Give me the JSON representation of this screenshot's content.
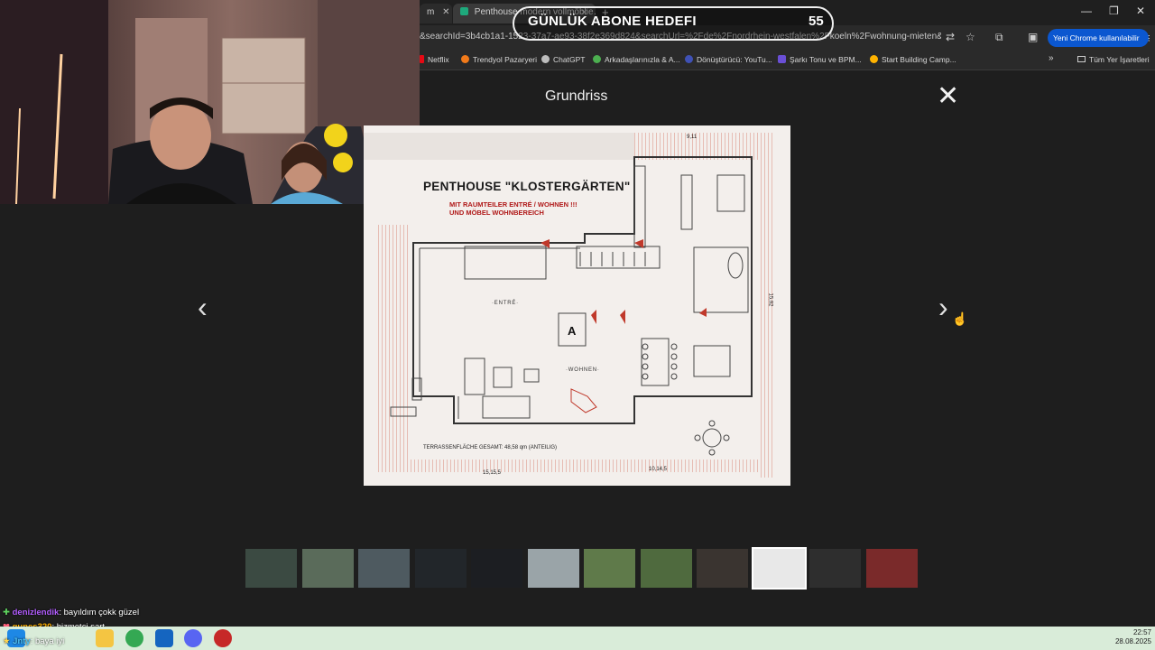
{
  "browser": {
    "tabs": [
      {
        "label": "m",
        "close": "✕"
      },
      {
        "label": "Penthouse modern vollmöblie…",
        "close": "✕"
      }
    ],
    "new_tab": "+",
    "window_controls": {
      "minimize": "—",
      "restore": "❐",
      "close": "✕"
    },
    "url": "&searchId=3b4cb1a1-1523-37a7-ae93-38f2e369d824&searchUrl=%2Fde%2Fnordrhein-westfalen%2Fkoeln%2Fwohnung-mieten&searchT...",
    "chrome_pill": "Yeni Chrome kullanılabilir",
    "chrome_pill_menu": "⋮",
    "bookmarks": [
      {
        "label": "Netflix",
        "color": "#e50914"
      },
      {
        "label": "Trendyol Pazaryeri",
        "color": "#f27a1a"
      },
      {
        "label": "ChatGPT",
        "color": "#bdbdbd"
      },
      {
        "label": "Arkadaşlarınızla & A...",
        "color": "#4caf50"
      },
      {
        "label": "Dönüştürücü: YouTu...",
        "color": "#3f51b5"
      },
      {
        "label": "Şarkı Tonu ve BPM...",
        "color": "#6a4fd6"
      },
      {
        "label": "Start Building Camp...",
        "color": "#ffb300"
      }
    ],
    "bookmarks_more": "»",
    "all_bookmarks": "Tüm Yer İşaretleri"
  },
  "overlay": {
    "goal_label": "GÜNLÜK ABONE HEDEFI",
    "goal_count": "55"
  },
  "lightbox": {
    "title": "Grundriss",
    "close": "✕",
    "prev": "‹",
    "next": "›",
    "cursor": "☝"
  },
  "floorplan": {
    "title": "PENTHOUSE \"KLOSTERGÄRTEN\"",
    "subtitle_1": "MIT RAUMTEILER ENTRÉ / WOHNEN !!!",
    "subtitle_2": "UND MÖBEL WOHNBEREICH",
    "room_entre": "·ENTRÉ·",
    "room_wohnen": "·WOHNEN·",
    "room_a": "A",
    "terrace_note": "TERRASSENFLÄCHE GESAMT: 48,58 qm (ANTEILIG)",
    "dim_top": "9,11",
    "dim_right": "15,92",
    "dim_bottom_left": "15,15,5",
    "dim_bottom_right": "10,14,5"
  },
  "thumbnails": {
    "count": 12,
    "active_index": 9,
    "colors": [
      "#3b4a42",
      "#5a6b5a",
      "#4e5a60",
      "#22262a",
      "#1c1e22",
      "#9aa4a8",
      "#5f7a4a",
      "#4f6a3e",
      "#3a3430",
      "#e8e8e8",
      "#2e2e2e",
      "#7a2a2a"
    ]
  },
  "chat": [
    {
      "user": "denizlendik",
      "icon": "✚",
      "message": ": bayıldım çokk güzel"
    },
    {
      "user": "gunes320",
      "icon": "❤",
      "message": ": hizmetçi şart"
    },
    {
      "user": "Jnty",
      "icon": "★",
      "message": ": baya iyi"
    }
  ],
  "taskbar": {
    "apps": [
      {
        "name": "windows-start",
        "color": "#1e88e5"
      },
      {
        "name": "explorer",
        "color": "#f4c542"
      },
      {
        "name": "chrome",
        "color": "#34a853"
      },
      {
        "name": "app-blue",
        "color": "#1565c0"
      },
      {
        "name": "discord",
        "color": "#5865f2"
      },
      {
        "name": "app-red",
        "color": "#c62828"
      }
    ],
    "time": "22:57",
    "date": "28.08.2025"
  }
}
